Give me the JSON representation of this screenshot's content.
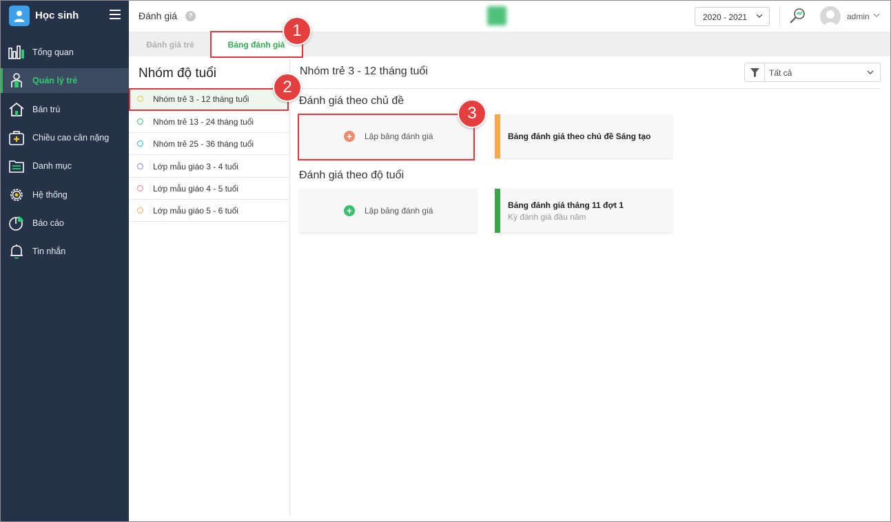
{
  "app": {
    "name": "Học sinh"
  },
  "sidebar": {
    "items": [
      {
        "label": "Tổng quan",
        "icon": "bar-chart-icon"
      },
      {
        "label": "Quản lý trẻ",
        "icon": "child-icon",
        "active": true
      },
      {
        "label": "Bán trú",
        "icon": "home-icon"
      },
      {
        "label": "Chiều cao cân nặng",
        "icon": "medical-box-icon"
      },
      {
        "label": "Danh mục",
        "icon": "folder-icon"
      },
      {
        "label": "Hệ thống",
        "icon": "gear-icon"
      },
      {
        "label": "Báo cáo",
        "icon": "pie-chart-icon"
      },
      {
        "label": "Tin nhắn",
        "icon": "bell-icon"
      }
    ]
  },
  "header": {
    "page_title": "Đánh giá",
    "help_label": "?",
    "year": "2020 - 2021",
    "user": "admin"
  },
  "tabs": [
    {
      "label": "Đánh giá trẻ",
      "active": false
    },
    {
      "label": "Bảng đánh giá",
      "active": true
    }
  ],
  "groups": {
    "heading": "Nhóm độ tuổi",
    "items": [
      {
        "label": "Nhóm trẻ 3 - 12 tháng tuổi",
        "dot_color": "#e8c23a",
        "selected": true
      },
      {
        "label": "Nhóm trẻ 13 - 24 tháng tuổi",
        "dot_color": "#3cb371"
      },
      {
        "label": "Nhóm trẻ 25 - 36 tháng tuổi",
        "dot_color": "#1fb3b3"
      },
      {
        "label": "Lớp mẫu giáo 3 - 4 tuổi",
        "dot_color": "#8a7fd6"
      },
      {
        "label": "Lớp mẫu giáo 4 - 5 tuổi",
        "dot_color": "#e8788a"
      },
      {
        "label": "Lớp mẫu giáo 5 - 6 tuổi",
        "dot_color": "#f0a050"
      }
    ]
  },
  "main": {
    "title": "Nhóm trẻ 3 - 12 tháng tuổi",
    "filter": "Tất cả",
    "sections": [
      {
        "title": "Đánh giá theo chủ đề",
        "add_label": "Lập bảng đánh giá",
        "add_color": "#f08a6c",
        "cards": [
          {
            "title": "Bảng đánh giá theo chủ đề Sáng tạo",
            "subtitle": "",
            "accent": "#f7a84a"
          }
        ]
      },
      {
        "title": "Đánh giá theo độ tuổi",
        "add_label": "Lập bảng đánh giá",
        "add_color": "#3cbf6a",
        "cards": [
          {
            "title": "Bảng đánh giá tháng 11 đợt 1",
            "subtitle": "Kỳ đánh giá đầu năm",
            "accent": "#3aa84a"
          }
        ]
      }
    ]
  },
  "annotations": [
    "1",
    "2",
    "3"
  ],
  "colors": {
    "sidebar_bg": "#253247",
    "accent_green": "#2eaa52",
    "highlight_red": "#e0353c"
  }
}
